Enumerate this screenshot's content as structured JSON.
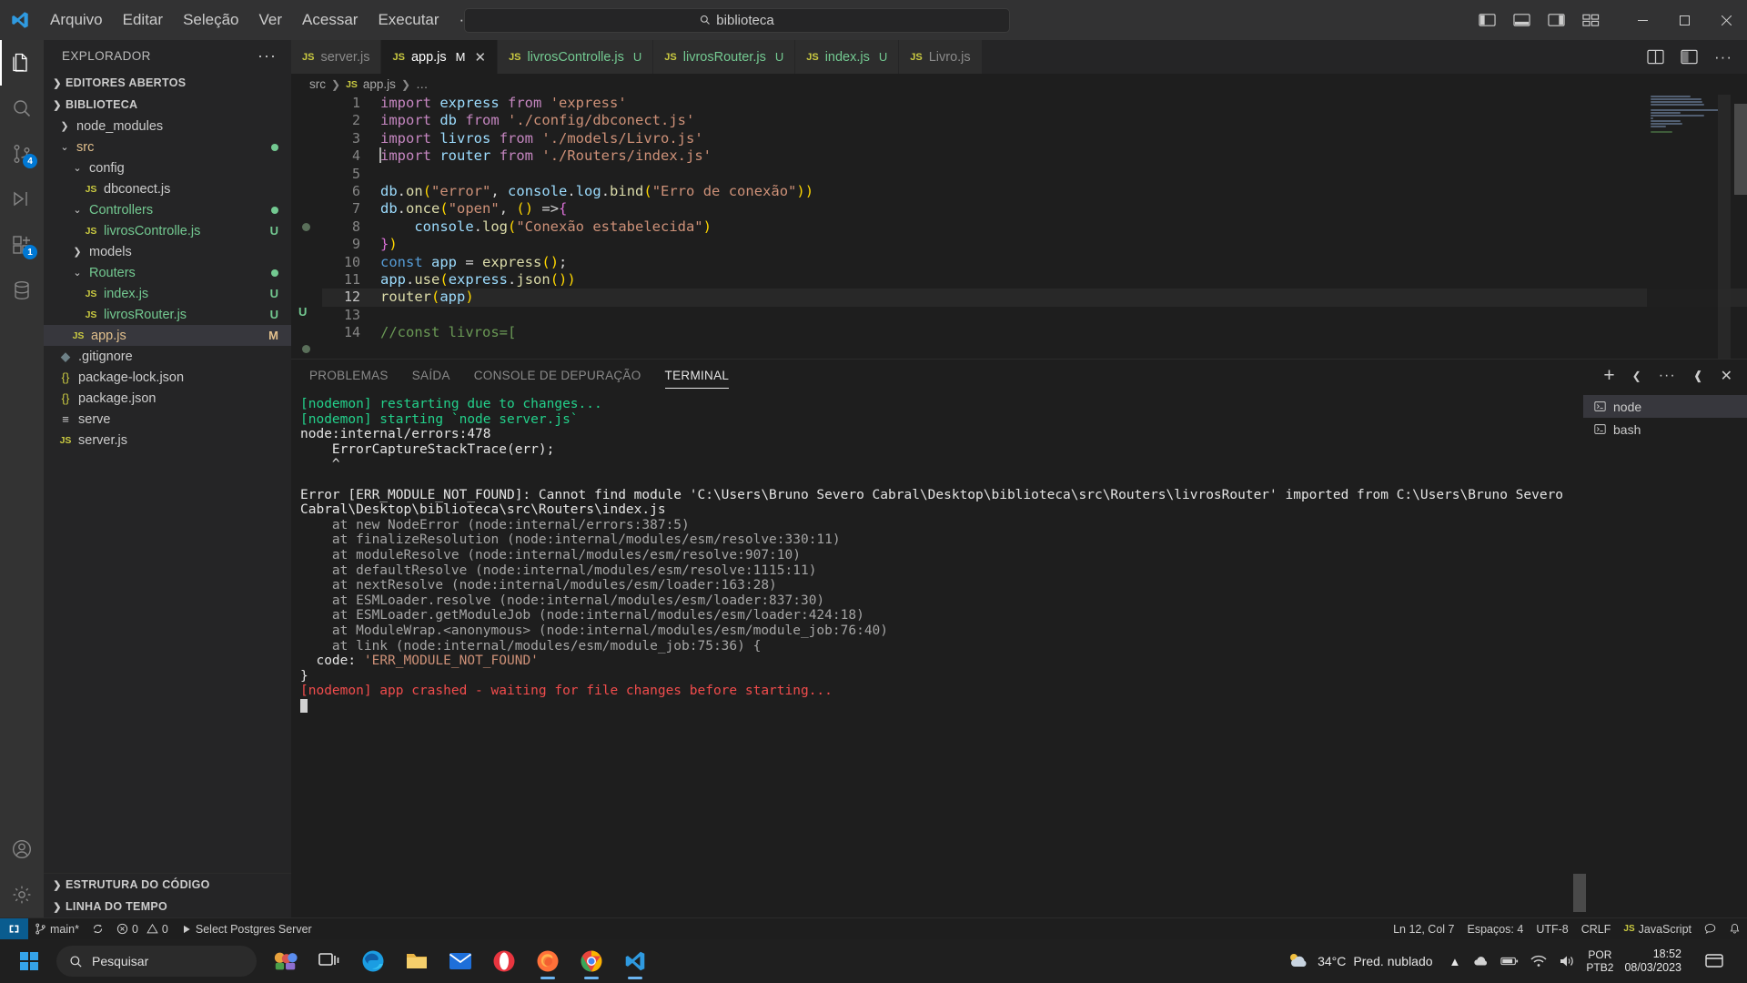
{
  "titlebar": {
    "menu": [
      "Arquivo",
      "Editar",
      "Seleção",
      "Ver",
      "Acessar",
      "Executar",
      "···"
    ],
    "back_icon": "arrow-left-icon",
    "forward_icon": "arrow-right-icon",
    "search_value": "biblioteca",
    "search_icon": "search-icon",
    "layout_icons": [
      "toggle-primary-sidebar-icon",
      "toggle-panel-icon",
      "toggle-secondary-sidebar-icon",
      "customize-layout-icon"
    ],
    "window_controls": [
      "minimize",
      "maximize",
      "close"
    ]
  },
  "activitybar": {
    "items": [
      {
        "name": "explorer",
        "icon": "files-icon",
        "active": true,
        "badge": ""
      },
      {
        "name": "search",
        "icon": "search-icon",
        "active": false,
        "badge": ""
      },
      {
        "name": "source-control",
        "icon": "source-control-icon",
        "active": false,
        "badge": "4"
      },
      {
        "name": "run-and-debug",
        "icon": "debug-icon",
        "active": false,
        "badge": ""
      },
      {
        "name": "extensions",
        "icon": "extensions-icon",
        "active": false,
        "badge": "1"
      },
      {
        "name": "database",
        "icon": "database-icon",
        "active": false,
        "badge": ""
      }
    ],
    "bottom": [
      {
        "name": "accounts",
        "icon": "account-icon"
      },
      {
        "name": "settings",
        "icon": "gear-icon"
      }
    ]
  },
  "sidebar": {
    "title": "EXPLORADOR",
    "more_label": "···",
    "sections": [
      {
        "label": "EDITORES ABERTOS",
        "expanded": false
      },
      {
        "label": "BIBLIOTECA",
        "expanded": true
      }
    ],
    "bottom_sections": [
      {
        "label": "ESTRUTURA DO CÓDIGO",
        "expanded": false
      },
      {
        "label": "LINHA DO TEMPO",
        "expanded": false
      }
    ],
    "tree": [
      {
        "label": "node_modules",
        "type": "folder",
        "expanded": false,
        "indent": 1,
        "status": "",
        "color": "#cccccc",
        "dirty": false
      },
      {
        "label": "src",
        "type": "folder",
        "expanded": true,
        "indent": 1,
        "status": "",
        "color": "#e2c08d",
        "dirty": true
      },
      {
        "label": "config",
        "type": "folder",
        "expanded": true,
        "indent": 2,
        "status": "",
        "color": "#cccccc",
        "dirty": false
      },
      {
        "label": "dbconect.js",
        "type": "js",
        "indent": 3,
        "status": "",
        "color": "#cccccc",
        "dirty": false
      },
      {
        "label": "Controllers",
        "type": "folder",
        "expanded": true,
        "indent": 2,
        "status": "",
        "color": "#73c991",
        "dirty": true
      },
      {
        "label": "livrosControlle.js",
        "type": "js",
        "indent": 3,
        "status": "U",
        "color": "#73c991",
        "dirty": false
      },
      {
        "label": "models",
        "type": "folder",
        "expanded": false,
        "indent": 2,
        "status": "",
        "color": "#cccccc",
        "dirty": false
      },
      {
        "label": "Routers",
        "type": "folder",
        "expanded": true,
        "indent": 2,
        "status": "",
        "color": "#73c991",
        "dirty": true
      },
      {
        "label": "index.js",
        "type": "js",
        "indent": 3,
        "status": "U",
        "color": "#73c991",
        "dirty": false
      },
      {
        "label": "livrosRouter.js",
        "type": "js",
        "indent": 3,
        "status": "U",
        "color": "#73c991",
        "dirty": false
      },
      {
        "label": "app.js",
        "type": "js",
        "indent": 2,
        "status": "M",
        "color": "#e2c08d",
        "dirty": false,
        "selected": true
      },
      {
        "label": ".gitignore",
        "type": "git",
        "indent": 1,
        "status": "",
        "color": "#cccccc",
        "dirty": false
      },
      {
        "label": "package-lock.json",
        "type": "json",
        "indent": 1,
        "status": "",
        "color": "#cccccc",
        "dirty": false
      },
      {
        "label": "package.json",
        "type": "json",
        "indent": 1,
        "status": "",
        "color": "#cccccc",
        "dirty": false
      },
      {
        "label": "serve",
        "type": "file",
        "indent": 1,
        "status": "",
        "color": "#cccccc",
        "dirty": false
      },
      {
        "label": "server.js",
        "type": "js",
        "indent": 1,
        "status": "",
        "color": "#cccccc",
        "dirty": false
      }
    ]
  },
  "editor": {
    "tabs": [
      {
        "label": "server.js",
        "icon": "js-icon",
        "state": "",
        "active": false,
        "untracked": false
      },
      {
        "label": "app.js",
        "icon": "js-icon",
        "state": "M",
        "active": true,
        "untracked": false,
        "close_icon": "close-icon"
      },
      {
        "label": "livrosControlle.js",
        "icon": "js-icon",
        "state": "U",
        "active": false,
        "untracked": true
      },
      {
        "label": "livrosRouter.js",
        "icon": "js-icon",
        "state": "U",
        "active": false,
        "untracked": true
      },
      {
        "label": "index.js",
        "icon": "js-icon",
        "state": "U",
        "active": false,
        "untracked": true
      },
      {
        "label": "Livro.js",
        "icon": "js-icon",
        "state": "",
        "active": false,
        "untracked": false
      }
    ],
    "tab_actions": [
      "split-editor-icon",
      "open-changes-icon",
      "more-actions-icon"
    ],
    "breadcrumb": [
      "src",
      "app.js",
      "…"
    ],
    "lines": [
      {
        "n": "1",
        "text": "import express from 'express'"
      },
      {
        "n": "2",
        "text": "import db from './config/dbconect.js'"
      },
      {
        "n": "3",
        "text": "import livros from './models/Livro.js'"
      },
      {
        "n": "4",
        "text": "import router from './Routers/index.js'"
      },
      {
        "n": "5",
        "text": ""
      },
      {
        "n": "6",
        "text": "db.on(\"error\", console.log.bind(\"Erro de conexão\"))"
      },
      {
        "n": "7",
        "text": "db.once(\"open\", () =>{"
      },
      {
        "n": "8",
        "text": "    console.log(\"Conexão estabelecida\")"
      },
      {
        "n": "9",
        "text": "})"
      },
      {
        "n": "10",
        "text": "const app = express();"
      },
      {
        "n": "11",
        "text": "app.use(express.json())"
      },
      {
        "n": "12",
        "text": "router(app)"
      },
      {
        "n": "13",
        "text": ""
      },
      {
        "n": "14",
        "text": "//const livros=["
      }
    ]
  },
  "panel": {
    "tabs": [
      {
        "label": "PROBLEMAS",
        "active": false
      },
      {
        "label": "SAÍDA",
        "active": false
      },
      {
        "label": "CONSOLE DE DEPURAÇÃO",
        "active": false
      },
      {
        "label": "TERMINAL",
        "active": true
      }
    ],
    "actions": [
      "new-terminal-icon",
      "chevron-down-icon",
      "more-actions-icon",
      "maximize-panel-icon",
      "close-panel-icon"
    ],
    "terminal_list": [
      {
        "label": "node",
        "icon": "terminal-icon",
        "active": true
      },
      {
        "label": "bash",
        "icon": "terminal-icon",
        "active": false
      }
    ],
    "terminal_output": [
      {
        "text": "[nodemon] restarting due to changes...",
        "color": "green"
      },
      {
        "text": "[nodemon] starting `node server.js`",
        "color": "green"
      },
      {
        "text": "node:internal/errors:478",
        "color": "white"
      },
      {
        "text": "    ErrorCaptureStackTrace(err);",
        "color": "white"
      },
      {
        "text": "    ^",
        "color": "white"
      },
      {
        "text": "",
        "color": "white"
      },
      {
        "text": "Error [ERR_MODULE_NOT_FOUND]: Cannot find module 'C:\\Users\\Bruno Severo Cabral\\Desktop\\biblioteca\\src\\Routers\\livrosRouter' imported from C:\\Users\\Bruno Severo Cabral\\Desktop\\biblioteca\\src\\Routers\\index.js",
        "color": "white"
      },
      {
        "text": "    at new NodeError (node:internal/errors:387:5)",
        "color": "grey"
      },
      {
        "text": "    at finalizeResolution (node:internal/modules/esm/resolve:330:11)",
        "color": "grey"
      },
      {
        "text": "    at moduleResolve (node:internal/modules/esm/resolve:907:10)",
        "color": "grey"
      },
      {
        "text": "    at defaultResolve (node:internal/modules/esm/resolve:1115:11)",
        "color": "grey"
      },
      {
        "text": "    at nextResolve (node:internal/modules/esm/loader:163:28)",
        "color": "grey"
      },
      {
        "text": "    at ESMLoader.resolve (node:internal/modules/esm/loader:837:30)",
        "color": "grey"
      },
      {
        "text": "    at ESMLoader.getModuleJob (node:internal/modules/esm/loader:424:18)",
        "color": "grey"
      },
      {
        "text": "    at ModuleWrap.<anonymous> (node:internal/modules/esm/module_job:76:40)",
        "color": "grey"
      },
      {
        "text": "    at link (node:internal/modules/esm/module_job:75:36) {",
        "color": "grey"
      },
      {
        "text": "  code: 'ERR_MODULE_NOT_FOUND'",
        "color": "white-orange"
      },
      {
        "text": "}",
        "color": "white"
      },
      {
        "text": "[nodemon] app crashed - waiting for file changes before starting...",
        "color": "red"
      }
    ],
    "code_label": "  code: ",
    "code_value": "'ERR_MODULE_NOT_FOUND'"
  },
  "statusbar": {
    "remote_icon": "remote-window-icon",
    "branch": "main*",
    "branch_icon": "source-control-icon",
    "sync_icon": "sync-icon",
    "errors": "0",
    "warnings": "0",
    "error_icon": "error-icon",
    "warning_icon": "warning-icon",
    "postgres": "Select Postgres Server",
    "postgres_icon": "play-icon",
    "cursor_position": "Ln 12, Col 7",
    "spaces": "Espaços: 4",
    "encoding": "UTF-8",
    "eol": "CRLF",
    "language": "JavaScript",
    "language_icon": "js-icon",
    "feedback_icon": "feedback-icon",
    "bell_icon": "bell-icon"
  },
  "taskbar": {
    "start_icon": "windows-start-icon",
    "search_placeholder": "Pesquisar",
    "search_icon": "search-icon",
    "pinned": [
      {
        "name": "widgets-icon",
        "running": false
      },
      {
        "name": "task-view-icon",
        "running": false
      },
      {
        "name": "microsoft-edge-icon",
        "running": false
      },
      {
        "name": "file-explorer-icon",
        "running": false
      },
      {
        "name": "mail-icon",
        "running": false
      },
      {
        "name": "opera-icon",
        "running": false
      },
      {
        "name": "firefox-icon",
        "running": true
      },
      {
        "name": "google-chrome-icon",
        "running": true
      },
      {
        "name": "vscode-icon",
        "running": true
      }
    ],
    "weather_temp": "34°C",
    "weather_desc": "Pred. nublado",
    "weather_icon": "cloud-sun-icon",
    "tray_icons": [
      "chevron-up-icon",
      "onedrive-icon",
      "battery-icon",
      "wifi-icon",
      "volume-icon"
    ],
    "lang_line1": "POR",
    "lang_line2": "PTB2",
    "clock_time": "18:52",
    "clock_date": "08/03/2023",
    "notification_icon": "notifications-icon"
  },
  "colors": {
    "accent": "#0078d4",
    "bg": "#1e1e1e",
    "sidebar_bg": "#252526",
    "activitybar_bg": "#333333",
    "titlebar_bg": "#323233",
    "green": "#73c991",
    "yellow": "#cbcb41",
    "error_red": "#f14c4c"
  }
}
